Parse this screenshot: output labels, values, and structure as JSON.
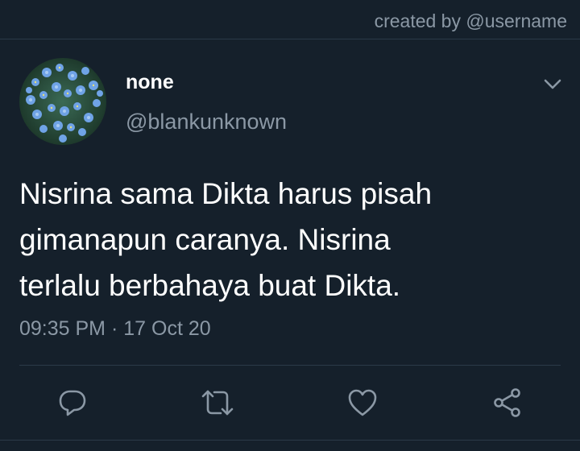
{
  "header": {
    "credit": "created by @username"
  },
  "tweet": {
    "display_name": "none",
    "handle": "@blankunknown",
    "text": "Nisrina sama Dikta harus pisah\ngimanapun caranya. Nisrina\nterlalu berbahaya buat Dikta.",
    "time": "09:35 PM",
    "separator": "·",
    "date": "17 Oct 20"
  },
  "icons": {
    "menu": "chevron-down-icon",
    "reply": "reply-icon",
    "retweet": "retweet-icon",
    "like": "heart-icon",
    "share": "share-icon"
  },
  "colors": {
    "background": "#15202b",
    "secondary_text": "#8b98a5",
    "divider": "#2b3a48",
    "avatar_flowers": "#6fa3e6"
  }
}
